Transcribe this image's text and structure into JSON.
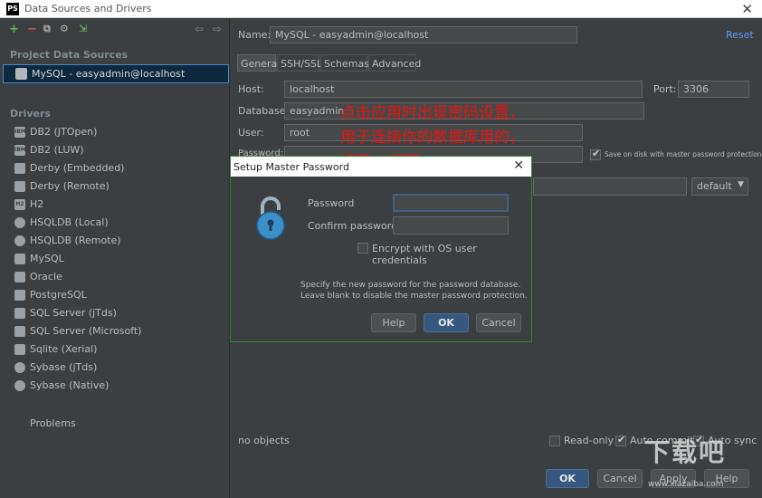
{
  "window": {
    "title": "Data Sources and Drivers",
    "app_icon_text": "PS",
    "close_glyph": "✕"
  },
  "sidebar": {
    "project_section": "Project Data Sources",
    "selected_source": "MySQL - easyadmin@localhost",
    "drivers_section": "Drivers",
    "drivers": [
      {
        "label": "DB2 (JTOpen)",
        "icon": "ibm-icon",
        "icon_text": "IBM"
      },
      {
        "label": "DB2 (LUW)",
        "icon": "ibm-icon",
        "icon_text": "IBM"
      },
      {
        "label": "Derby (Embedded)",
        "icon": "derby-icon",
        "icon_text": ""
      },
      {
        "label": "Derby (Remote)",
        "icon": "derby-icon",
        "icon_text": ""
      },
      {
        "label": "H2",
        "icon": "h2-icon",
        "icon_text": "H2"
      },
      {
        "label": "HSQLDB (Local)",
        "icon": "hsqldb-icon",
        "icon_text": ""
      },
      {
        "label": "HSQLDB (Remote)",
        "icon": "hsqldb-icon",
        "icon_text": ""
      },
      {
        "label": "MySQL",
        "icon": "mysql-icon",
        "icon_text": ""
      },
      {
        "label": "Oracle",
        "icon": "oracle-icon",
        "icon_text": ""
      },
      {
        "label": "PostgreSQL",
        "icon": "postgresql-icon",
        "icon_text": ""
      },
      {
        "label": "SQL Server (jTds)",
        "icon": "sqlserver-icon",
        "icon_text": ""
      },
      {
        "label": "SQL Server (Microsoft)",
        "icon": "sqlserver-icon",
        "icon_text": ""
      },
      {
        "label": "Sqlite (Xerial)",
        "icon": "sqlite-icon",
        "icon_text": ""
      },
      {
        "label": "Sybase (jTds)",
        "icon": "sybase-icon",
        "icon_text": ""
      },
      {
        "label": "Sybase (Native)",
        "icon": "sybase-icon",
        "icon_text": ""
      }
    ],
    "problems": "Problems"
  },
  "main": {
    "name_label": "Name:",
    "name_value": "MySQL - easyadmin@localhost",
    "reset": "Reset",
    "tabs": [
      "General",
      "SSH/SSL",
      "Schemas",
      "Advanced"
    ],
    "host_label": "Host:",
    "host_value": "localhost",
    "port_label": "Port:",
    "port_value": "3306",
    "database_label": "Database:",
    "database_value": "easyadmin",
    "user_label": "User:",
    "user_value": "root",
    "password_label": "Password:",
    "save_on_disk": "Save on disk with master password protection",
    "default_select": "default",
    "no_objects": "no objects",
    "read_only": "Read-only",
    "auto_commit": "Auto commit",
    "auto_sync": "Auto sync",
    "buttons": {
      "ok": "OK",
      "cancel": "Cancel",
      "apply": "Apply",
      "help": "Help"
    }
  },
  "annotation": {
    "line1": "点击应用时出现密码设置，",
    "line2": "用于连接你的数据库用的，",
    "line3": "填写ok即可"
  },
  "dialog": {
    "title": "Setup Master Password",
    "password_label": "Password",
    "confirm_label": "Confirm password",
    "encrypt_label": "Encrypt with OS user credentials",
    "message_line1": "Specify the new password for the password database.",
    "message_line2": "Leave blank to disable the master password protection.",
    "help": "Help",
    "ok": "OK",
    "cancel": "Cancel"
  },
  "watermark": {
    "text": "下载吧",
    "sub": "www.xiazaiba.com"
  }
}
